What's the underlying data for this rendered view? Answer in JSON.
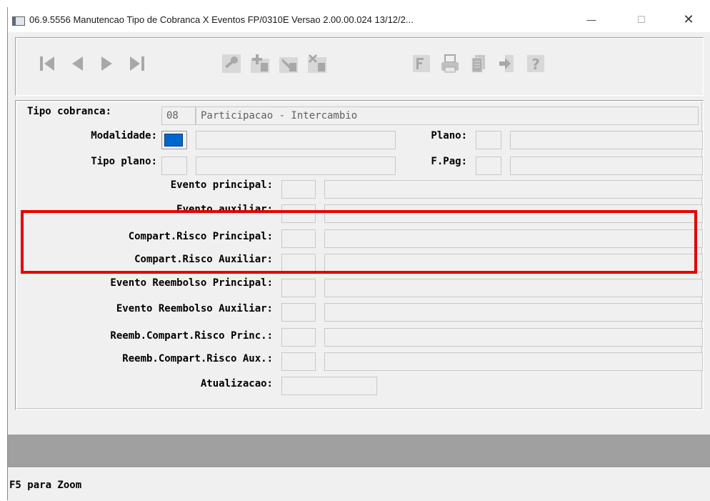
{
  "window": {
    "title": "06.9.5556 Manutencao  Tipo de Cobranca X Eventos FP/0310E Versao 2.00.00.024 13/12/2...",
    "minimize_glyph": "—",
    "maximize_glyph": "☐",
    "close_glyph": "✕"
  },
  "toolbar": {
    "buttons": [
      {
        "name": "first-record-icon"
      },
      {
        "name": "previous-record-icon"
      },
      {
        "name": "next-record-icon"
      },
      {
        "name": "last-record-icon"
      },
      {
        "name": "search-key-icon"
      },
      {
        "name": "add-record-icon"
      },
      {
        "name": "edit-record-icon"
      },
      {
        "name": "delete-record-icon"
      },
      {
        "name": "filter-icon"
      },
      {
        "name": "print-icon"
      },
      {
        "name": "copy-icon"
      },
      {
        "name": "exit-icon"
      },
      {
        "name": "help-icon"
      }
    ]
  },
  "form": {
    "tipo_cobranca": {
      "label": "Tipo cobranca:",
      "code": "08",
      "description": "Participacao - Intercambio"
    },
    "modalidade": {
      "label": "Modalidade:",
      "code": "",
      "description": ""
    },
    "plano": {
      "label": "Plano:",
      "code": "",
      "description": ""
    },
    "tipo_plano": {
      "label": "Tipo plano:",
      "code": "",
      "description": ""
    },
    "f_pag": {
      "label": "F.Pag:",
      "code": "",
      "description": ""
    },
    "evento_principal": {
      "label": "Evento principal:",
      "code": "",
      "description": ""
    },
    "evento_auxiliar": {
      "label": "Evento auxiliar:",
      "code": "",
      "description": ""
    },
    "compart_risco_principal": {
      "label": "Compart.Risco Principal:",
      "code": "",
      "description": ""
    },
    "compart_risco_auxiliar": {
      "label": "Compart.Risco Auxiliar:",
      "code": "",
      "description": ""
    },
    "evento_reembolso_principal": {
      "label": "Evento Reembolso Principal:",
      "code": "",
      "description": ""
    },
    "evento_reembolso_auxiliar": {
      "label": "Evento Reembolso Auxiliar:",
      "code": "",
      "description": ""
    },
    "reemb_compart_risco_princ": {
      "label": "Reemb.Compart.Risco Princ.:",
      "code": "",
      "description": ""
    },
    "reemb_compart_risco_aux": {
      "label": "Reemb.Compart.Risco Aux.:",
      "code": "",
      "description": ""
    },
    "atualizacao": {
      "label": "Atualizacao:",
      "value": ""
    }
  },
  "status": {
    "hint": "F5 para Zoom"
  },
  "colors": {
    "highlight_border": "#e60000",
    "focus_fill": "#0066cc"
  }
}
